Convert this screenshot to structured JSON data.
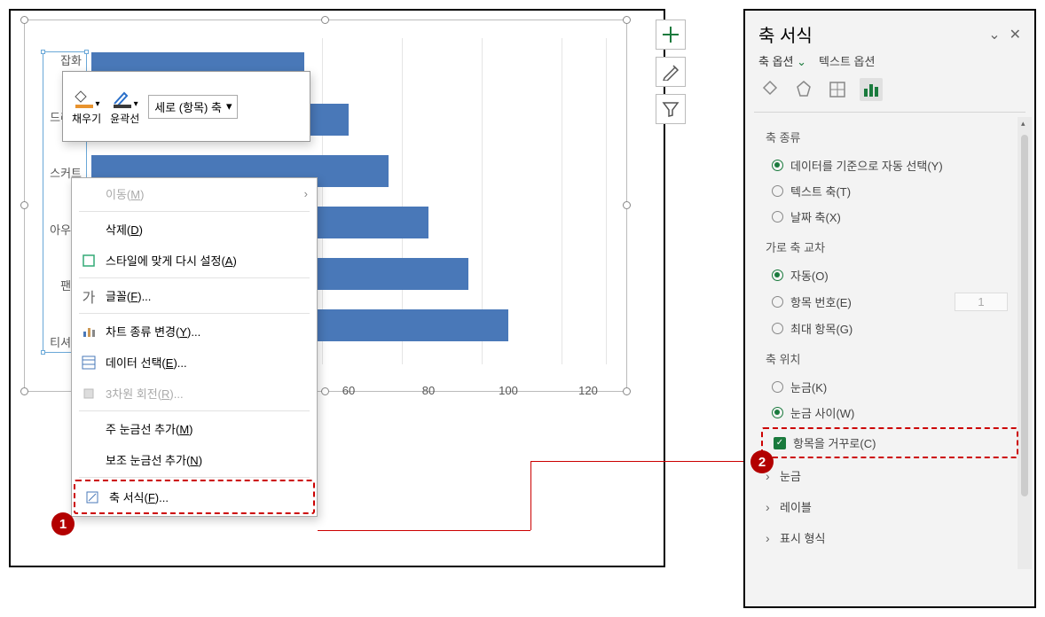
{
  "chart_data": {
    "type": "bar",
    "orientation": "horizontal",
    "categories": [
      "잡화",
      "드레스",
      "스커트",
      "아우터",
      "팬츠",
      "티셔츠"
    ],
    "values": [
      60,
      70,
      80,
      90,
      100,
      110
    ],
    "xlabel": "",
    "ylabel": "",
    "x_ticks": [
      60,
      80,
      100,
      120
    ]
  },
  "mini_toolbar": {
    "fill_label": "채우기",
    "outline_label": "윤곽선",
    "axis_dropdown": "세로 (항목) 축"
  },
  "context_menu": {
    "move": {
      "text": "이동",
      "shortcut": "M"
    },
    "delete": {
      "text": "삭제",
      "shortcut": "D"
    },
    "reset": {
      "text": "스타일에 맞게 다시 설정",
      "shortcut": "A"
    },
    "font": {
      "text": "글꼴",
      "shortcut": "F",
      "suffix": "..."
    },
    "chart_type": {
      "text": "차트 종류 변경",
      "shortcut": "Y",
      "suffix": "..."
    },
    "select_data": {
      "text": "데이터 선택",
      "shortcut": "E",
      "suffix": "..."
    },
    "rotate3d": {
      "text": "3차원 회전",
      "shortcut": "R",
      "suffix": "..."
    },
    "major_grid": {
      "text": "주 눈금선 추가",
      "shortcut": "M"
    },
    "minor_grid": {
      "text": "보조 눈금선 추가",
      "shortcut": "N"
    },
    "format_axis": {
      "text": "축 서식",
      "shortcut": "F",
      "suffix": "..."
    }
  },
  "format_pane": {
    "title": "축 서식",
    "tab_axis": "축 옵션",
    "tab_text": "텍스트 옵션",
    "axis_type_label": "축 종류",
    "auto_by_data": "데이터를 기준으로 자동 선택(Y)",
    "text_axis": "텍스트 축(T)",
    "date_axis": "날짜 축(X)",
    "cross_label": "가로 축 교차",
    "auto_o": "자동(O)",
    "item_num": "항목 번호(E)",
    "item_num_val": "1",
    "max_item": "최대 항목(G)",
    "position_label": "축 위치",
    "tick_k": "눈금(K)",
    "between_tick": "눈금 사이(W)",
    "reverse": "항목을 거꾸로(C)",
    "expand_tick": "눈금",
    "expand_label": "레이블",
    "expand_format": "표시 형식"
  },
  "annotations": {
    "num1": "1",
    "num2": "2"
  }
}
